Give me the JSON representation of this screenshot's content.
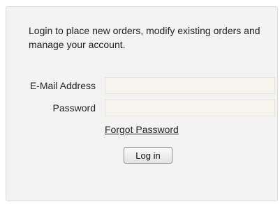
{
  "login": {
    "intro_text": "Login to place new orders, modify existing orders and manage your account.",
    "email_label": "E-Mail Address",
    "email_value": "",
    "password_label": "Password",
    "password_value": "",
    "forgot_link": "Forgot Password",
    "login_button": "Log in"
  },
  "colors": {
    "panel_background": "#f3f3f3",
    "field_background": "#f7f5ee"
  }
}
